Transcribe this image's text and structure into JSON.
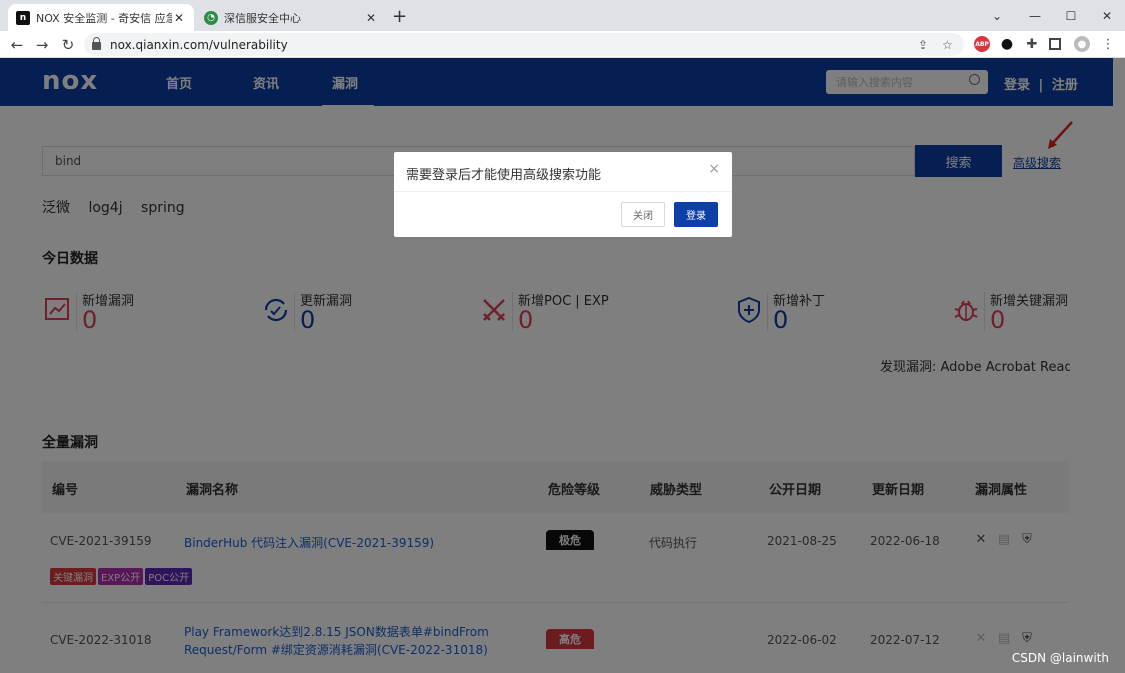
{
  "browser": {
    "tabs": [
      {
        "title": "NOX 安全监测 - 奇安信 应急响应",
        "active": true
      },
      {
        "title": "深信服安全中心",
        "active": false
      }
    ],
    "new_tab": "+",
    "close_glyph": "✕",
    "window_controls": [
      "⌄",
      "—",
      "☐",
      "✕"
    ],
    "url": "nox.qianxin.com/vulnerability",
    "extensions": [
      "ABP",
      "●",
      "puzzle-icon",
      "sidebar-icon",
      "profile-icon",
      "menu-icon"
    ]
  },
  "header": {
    "logo": "nox",
    "nav": [
      {
        "label": "首页"
      },
      {
        "label": "资讯"
      },
      {
        "label": "漏洞",
        "active": true
      }
    ],
    "search_placeholder": "请输入搜索内容",
    "login": "登录",
    "separator": "|",
    "register": "注册",
    "color": "#0c3fa7"
  },
  "search": {
    "value": "bind",
    "button": "搜索",
    "advanced": "高级搜索",
    "hot_tags": [
      "泛微",
      "log4j",
      "spring"
    ]
  },
  "today": {
    "title": "今日数据",
    "stats": [
      {
        "label": "新增漏洞",
        "value": "0",
        "icon": "trend-chart-icon"
      },
      {
        "label": "更新漏洞",
        "value": "0",
        "icon": "refresh-icon"
      },
      {
        "label": "新增POC | EXP",
        "value": "0",
        "icon": "crossed-swords-icon"
      },
      {
        "label": "新增补丁",
        "value": "0",
        "icon": "shield-plus-icon"
      },
      {
        "label": "新增关键漏洞",
        "value": "0",
        "icon": "bug-icon"
      }
    ],
    "ticker": "发现漏洞: Adobe Acrobat Reader"
  },
  "vulns": {
    "title": "全量漏洞",
    "columns": [
      "编号",
      "漏洞名称",
      "危险等级",
      "威胁类型",
      "公开日期",
      "更新日期",
      "漏洞属性"
    ],
    "rows": [
      {
        "cve": "CVE-2021-39159",
        "name": "BinderHub 代码注入漏洞(CVE-2021-39159)",
        "severity": "极危",
        "severity_color": "#111111",
        "threat": "代码执行",
        "published": "2021-08-25",
        "updated": "2022-06-18",
        "badges": [
          {
            "text": "关键漏洞",
            "color": "#d9363e"
          },
          {
            "text": "EXP公开",
            "color": "#b030b0"
          },
          {
            "text": "POC公开",
            "color": "#5a2ab8"
          }
        ]
      },
      {
        "cve": "CVE-2022-31018",
        "name": "Play Framework达到2.8.15 JSON数据表单#bindFrom Request/Form #绑定资源消耗漏洞(CVE-2022-31018)",
        "severity": "高危",
        "severity_color": "#d9363e",
        "threat": "",
        "published": "2022-06-02",
        "updated": "2022-07-12",
        "badges": []
      }
    ]
  },
  "modal": {
    "title": "需要登录后才能使用高级搜索功能",
    "close_x": "×",
    "cancel": "关闭",
    "confirm": "登录"
  },
  "watermark": "CSDN @lainwith"
}
